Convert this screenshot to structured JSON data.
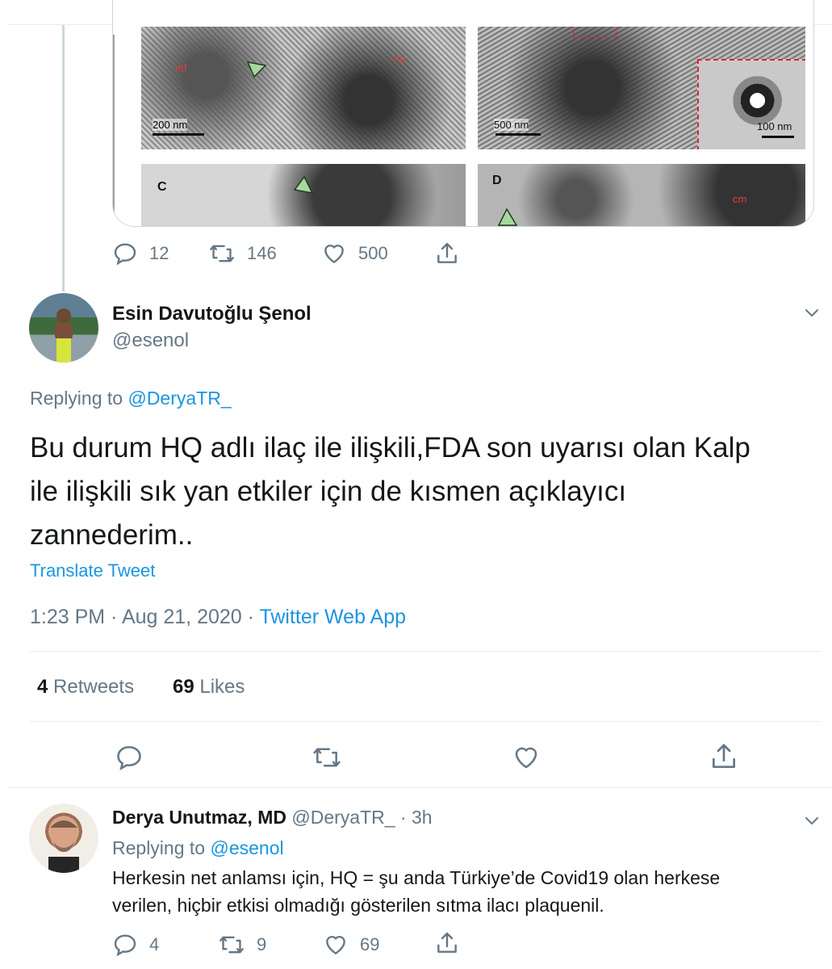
{
  "quoted_media": {
    "panel_labels": {
      "a_left": "mf",
      "a_right": "nu",
      "b_box": "",
      "c": "C",
      "d": "D",
      "d_right": "cm"
    },
    "scales": {
      "a": "200 nm",
      "b": "500 nm",
      "b_inset": "100 nm"
    }
  },
  "parent_actions": {
    "replies": "12",
    "retweets": "146",
    "likes": "500"
  },
  "main_tweet": {
    "name": "Esin Davutoğlu Şenol",
    "handle": "@esenol",
    "replying_prefix": "Replying to ",
    "replying_to": "@DeryaTR_",
    "text_line1": "Bu durum HQ adlı ilaç ile ilişkili,FDA son uyarısı olan Kalp",
    "text_line2": "ile ilişkili sık yan etkiler için de kısmen açıklayıcı",
    "text_line3": "zannederim..",
    "translate": "Translate Tweet",
    "time": "1:23 PM · Aug 21, 2020 · ",
    "app": "Twitter Web App",
    "retweets_count": "4",
    "retweets_label": " Retweets",
    "likes_count": "69",
    "likes_label": " Likes"
  },
  "reply_tweet": {
    "name": "Derya Unutmaz, MD",
    "handle": "@DeryaTR_",
    "age": " · 3h",
    "replying_prefix": "Replying to ",
    "replying_to": "@esenol",
    "text_line1": "Herkesin net anlamsı için, HQ = şu anda Türkiye’de Covid19 olan herkese",
    "text_line2": "verilen, hiçbir etkisi olmadığı gösterilen sıtma ilacı plaquenil.",
    "replies": "4",
    "retweets": "9",
    "likes": "69"
  },
  "colors": {
    "accent": "#1b95e0",
    "secondary_text": "#657786",
    "divider": "#e6ecf0"
  }
}
